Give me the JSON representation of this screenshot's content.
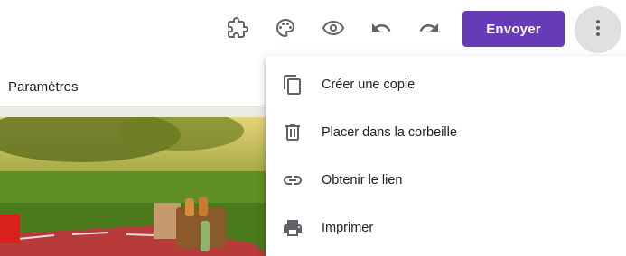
{
  "toolbar": {
    "icons": [
      "puzzle-icon",
      "palette-icon",
      "eye-icon",
      "undo-icon",
      "redo-icon"
    ],
    "send_label": "Envoyer",
    "more_icon": "more-vert-icon",
    "accent_color": "#673ab7"
  },
  "left_panel": {
    "tab_label": "Paramètres"
  },
  "menu": {
    "items": [
      {
        "label": "Créer une copie",
        "icon": "copy-icon"
      },
      {
        "label": "Placer dans la corbeille",
        "icon": "trash-icon"
      },
      {
        "label": "Obtenir le lien",
        "icon": "link-icon"
      },
      {
        "label": "Imprimer",
        "icon": "print-icon"
      }
    ]
  }
}
